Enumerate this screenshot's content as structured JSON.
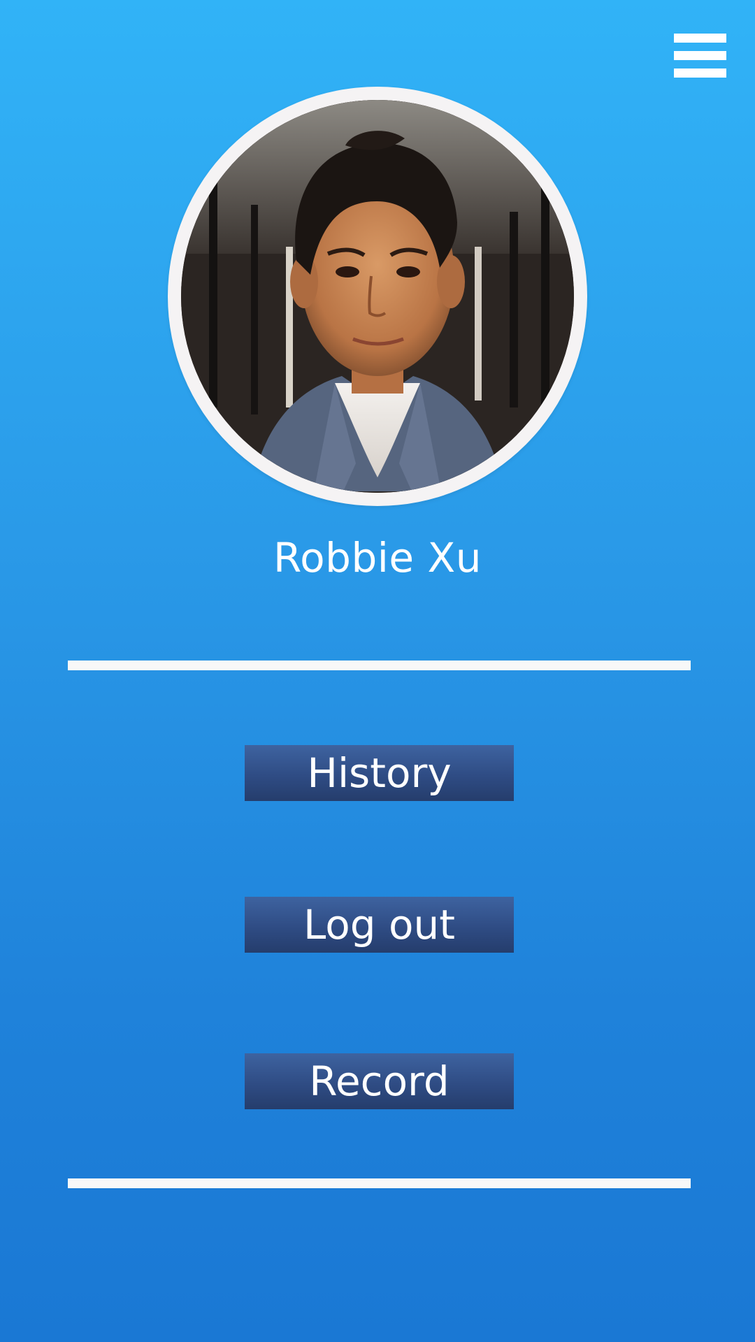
{
  "header": {
    "menu_icon": "hamburger-menu-icon"
  },
  "profile": {
    "name": "Robbie Xu",
    "avatar_icon": "profile-photo"
  },
  "actions": {
    "history_label": "History",
    "logout_label": "Log out",
    "record_label": "Record"
  },
  "colors": {
    "background_top": "#31b3f7",
    "background_bottom": "#1a78d4",
    "button": "#2f4c84",
    "divider": "#f8f8f8",
    "ring": "#f5f3f4",
    "text": "#ffffff"
  }
}
